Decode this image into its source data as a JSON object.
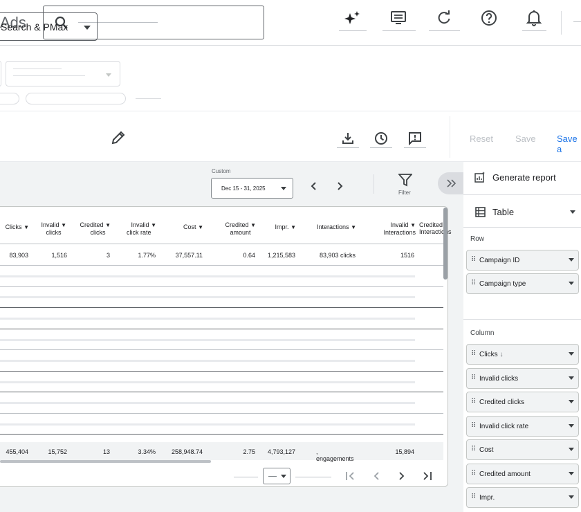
{
  "header": {
    "brand": "Ads",
    "icons": [
      "sparkle-icon",
      "message-icon",
      "refresh-icon",
      "help-icon",
      "bell-icon"
    ]
  },
  "toolbar": {
    "campaign_select": "Search & PMax",
    "reset": "Reset",
    "save": "Save",
    "save_as": "Save a"
  },
  "date": {
    "label": "Custom",
    "range": "Dec 15 - 31, 2025",
    "filter_label": "Filter"
  },
  "table": {
    "headers": [
      [
        "Clicks",
        ""
      ],
      [
        "Invalid",
        "clicks"
      ],
      [
        "Credited",
        "clicks"
      ],
      [
        "Invalid",
        "click rate"
      ],
      [
        "Cost",
        ""
      ],
      [
        "Credited",
        "amount"
      ],
      [
        "Impr.",
        ""
      ],
      [
        "Interactions",
        ""
      ],
      [
        "Invalid",
        "Interactions"
      ],
      [
        "Credited",
        "Interactions"
      ]
    ],
    "first_row": [
      "83,903",
      "1,516",
      "3",
      "1.77%",
      "37,557.11",
      "0.64",
      "1,215,583",
      "83,903 clicks",
      "1516"
    ],
    "total_row": [
      "455,404",
      "15,752",
      "13",
      "3.34%",
      "258,948.74",
      "2.75",
      "4,793,127",
      ", engagements",
      "15,894"
    ]
  },
  "panel": {
    "generate_report": "Generate report",
    "view_type": "Table",
    "row_label": "Row",
    "row_chips": [
      "Campaign ID",
      "Campaign type"
    ],
    "column_label": "Column",
    "column_chips": [
      "Clicks",
      "Invalid clicks",
      "Credited clicks",
      "Invalid click rate",
      "Cost",
      "Credited amount",
      "Impr."
    ],
    "sort_indicator": "↓"
  },
  "colors": {
    "accent": "#1a73e8",
    "muted": "#bdc1c6",
    "workspace": "#f1f3f4"
  }
}
